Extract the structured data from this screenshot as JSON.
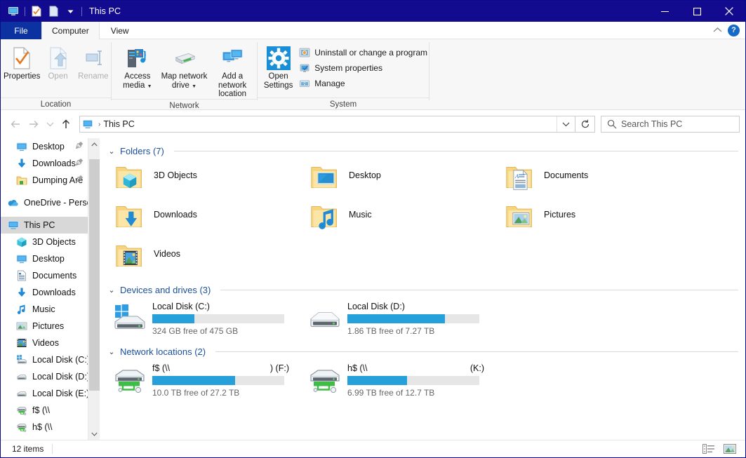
{
  "window": {
    "title": "This PC",
    "quick_access": [
      "this-pc-icon",
      "properties-icon",
      "new-folder-icon",
      "customize-dropdown-icon"
    ],
    "controls": {
      "minimize": "–",
      "maximize": "□",
      "close": "✕"
    }
  },
  "tabs": [
    {
      "label": "File",
      "state": "file"
    },
    {
      "label": "Computer",
      "state": "active"
    },
    {
      "label": "View",
      "state": "inactive"
    }
  ],
  "tabstrip_right": {
    "collapse": "collapse-ribbon-icon",
    "help": "?"
  },
  "ribbon": {
    "groups": [
      {
        "label": "Location",
        "buttons": [
          {
            "label": "Properties",
            "icon": "properties-icon",
            "disabled": false
          },
          {
            "label": "Open",
            "icon": "open-icon",
            "disabled": true
          },
          {
            "label": "Rename",
            "icon": "rename-icon",
            "disabled": true
          }
        ]
      },
      {
        "label": "Network",
        "buttons": [
          {
            "label": "Access media",
            "icon": "access-media-icon",
            "dropdown": true
          },
          {
            "label": "Map network drive",
            "icon": "map-network-drive-icon",
            "dropdown": true
          },
          {
            "label": "Add a network location",
            "icon": "add-network-location-icon",
            "dropdown": false
          }
        ]
      },
      {
        "label": "System",
        "big": {
          "label": "Open Settings",
          "icon": "settings-gear-icon"
        },
        "items": [
          {
            "label": "Uninstall or change a program",
            "icon": "uninstall-program-icon"
          },
          {
            "label": "System properties",
            "icon": "system-properties-icon"
          },
          {
            "label": "Manage",
            "icon": "manage-icon"
          }
        ]
      }
    ]
  },
  "addressbar": {
    "back": "back-arrow-icon",
    "forward": "forward-arrow-icon",
    "recent": "recent-locations-icon",
    "up": "up-arrow-icon",
    "breadcrumb_icon": "this-pc-icon",
    "breadcrumb": "This PC",
    "separator": "›",
    "dropdown": "chevron-down-icon",
    "refresh": "refresh-icon",
    "search_placeholder": "Search This PC"
  },
  "sidebar": {
    "items": [
      {
        "label": "Desktop",
        "icon": "desktop-icon",
        "indent": "child",
        "pinned": true,
        "selected": false
      },
      {
        "label": "Downloads",
        "icon": "downloads-icon",
        "indent": "child",
        "pinned": true,
        "selected": false
      },
      {
        "label": "Dumping Are",
        "icon": "folder-icon",
        "indent": "child",
        "pinned": true,
        "selected": false
      },
      {
        "label": "GAP",
        "icon": "",
        "indent": "gap",
        "pinned": false,
        "selected": false
      },
      {
        "label": "OneDrive - Person",
        "icon": "onedrive-icon",
        "indent": "root",
        "pinned": false,
        "selected": false
      },
      {
        "label": "GAP",
        "icon": "",
        "indent": "gap",
        "pinned": false,
        "selected": false
      },
      {
        "label": "This PC",
        "icon": "this-pc-icon",
        "indent": "root",
        "pinned": false,
        "selected": true
      },
      {
        "label": "3D Objects",
        "icon": "3d-objects-icon",
        "indent": "child",
        "pinned": false,
        "selected": false
      },
      {
        "label": "Desktop",
        "icon": "desktop-icon",
        "indent": "child",
        "pinned": false,
        "selected": false
      },
      {
        "label": "Documents",
        "icon": "documents-icon",
        "indent": "child",
        "pinned": false,
        "selected": false
      },
      {
        "label": "Downloads",
        "icon": "downloads-icon",
        "indent": "child",
        "pinned": false,
        "selected": false
      },
      {
        "label": "Music",
        "icon": "music-icon",
        "indent": "child",
        "pinned": false,
        "selected": false
      },
      {
        "label": "Pictures",
        "icon": "pictures-icon",
        "indent": "child",
        "pinned": false,
        "selected": false
      },
      {
        "label": "Videos",
        "icon": "videos-icon",
        "indent": "child",
        "pinned": false,
        "selected": false
      },
      {
        "label": "Local Disk (C:)",
        "icon": "windows-drive-icon",
        "indent": "child",
        "pinned": false,
        "selected": false
      },
      {
        "label": "Local Disk (D:)",
        "icon": "drive-icon",
        "indent": "child",
        "pinned": false,
        "selected": false
      },
      {
        "label": "Local Disk (E:)",
        "icon": "drive-icon",
        "indent": "child",
        "pinned": false,
        "selected": false
      },
      {
        "label": "f$ (\\\\",
        "icon": "network-drive-icon",
        "indent": "child",
        "pinned": false,
        "selected": false
      },
      {
        "label": "h$ (\\\\",
        "icon": "network-drive-icon",
        "indent": "child",
        "pinned": false,
        "selected": false
      }
    ]
  },
  "content": {
    "sections": [
      {
        "title": "Folders (7)",
        "chevron": "chevron-down-icon"
      },
      {
        "title": "Devices and drives (3)",
        "chevron": "chevron-down-icon"
      },
      {
        "title": "Network locations (2)",
        "chevron": "chevron-down-icon"
      }
    ],
    "folders": [
      {
        "name": "3D Objects",
        "icon": "folder-3d-objects-icon"
      },
      {
        "name": "Desktop",
        "icon": "folder-desktop-icon"
      },
      {
        "name": "Documents",
        "icon": "folder-documents-icon"
      },
      {
        "name": "Downloads",
        "icon": "folder-downloads-icon"
      },
      {
        "name": "Music",
        "icon": "folder-music-icon"
      },
      {
        "name": "Pictures",
        "icon": "folder-pictures-icon"
      },
      {
        "name": "Videos",
        "icon": "folder-videos-icon"
      }
    ],
    "drives": [
      {
        "name": "Local Disk (C:)",
        "icon": "windows-drive-icon",
        "free_text": "324 GB free of 475 GB",
        "used_pct": 32,
        "name_suffix": ""
      },
      {
        "name": "Local Disk (D:)",
        "icon": "drive-icon",
        "free_text": "1.86 TB free of 7.27 TB",
        "used_pct": 74,
        "name_suffix": ""
      }
    ],
    "network_locations": [
      {
        "name": "f$ (\\\\",
        "icon": "network-drive-icon",
        "free_text": "10.0 TB free of 27.2 TB",
        "used_pct": 63,
        "name_suffix": ") (F:)"
      },
      {
        "name": "h$ (\\\\",
        "icon": "network-drive-icon",
        "free_text": "6.99 TB free of 12.7 TB",
        "used_pct": 45,
        "name_suffix": "(K:)"
      }
    ]
  },
  "statusbar": {
    "item_count": "12 items",
    "views": [
      {
        "name": "details-view-icon",
        "active": false
      },
      {
        "name": "large-icons-view-icon",
        "active": true
      }
    ]
  },
  "colors": {
    "titlebar": "#120a8f",
    "file_tab": "#0b32a0",
    "section_title": "#1a4f9c",
    "progress_fill": "#26a0da",
    "progress_track": "#e6e6e6",
    "selection": "#d8d8d8",
    "ribbon_bg": "#f7f7f7"
  }
}
